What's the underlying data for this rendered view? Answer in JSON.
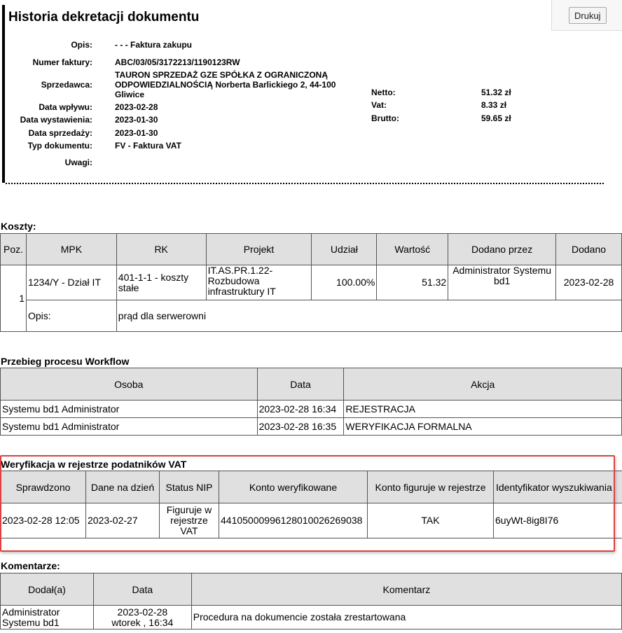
{
  "toolbar": {
    "print_label": "Drukuj"
  },
  "document": {
    "title": "Historia dekretacji dokumentu",
    "fields": {
      "opis_label": "Opis:",
      "opis_value": "- - - Faktura zakupu",
      "numer_label": "Numer faktury:",
      "numer_value": "ABC/03/05/3172213/1190123RW",
      "sprzedawca_label": "Sprzedawca:",
      "sprzedawca_value": "TAURON SPRZEDAŻ GZE SPÓŁKA Z OGRANICZONĄ ODPOWIEDZIALNOŚCIĄ Norberta Barlickiego 2, 44-100 Gliwice",
      "data_wplywu_label": "Data wpływu:",
      "data_wplywu_value": "2023-02-28",
      "data_wystawienia_label": "Data wystawienia:",
      "data_wystawienia_value": "2023-01-30",
      "data_sprzedazy_label": "Data sprzedaży:",
      "data_sprzedazy_value": "2023-01-30",
      "typ_label": "Typ dokumentu:",
      "typ_value": "FV - Faktura VAT",
      "uwagi_label": "Uwagi:",
      "uwagi_value": ""
    },
    "amounts": {
      "netto_label": "Netto:",
      "netto_value": "51.32 zł",
      "vat_label": "Vat:",
      "vat_value": "8.33 zł",
      "brutto_label": "Brutto:",
      "brutto_value": "59.65 zł"
    }
  },
  "koszty": {
    "title": "Koszty:",
    "headers": [
      "Poz.",
      "MPK",
      "RK",
      "Projekt",
      "Udział",
      "Wartość",
      "Dodano przez",
      "Dodano"
    ],
    "rows": [
      {
        "poz": "1",
        "mpk": "1234/Y - Dział IT",
        "rk": "401-1-1 - koszty stałe",
        "projekt": "IT.AS.PR.1.22-Rozbudowa infrastruktury IT",
        "udzial": "100.00%",
        "wartosc": "51.32",
        "dodano_przez": "Administrator Systemu bd1",
        "dodano": "2023-02-28",
        "opis_label": "Opis:",
        "opis_value": "prąd dla serwerowni"
      }
    ]
  },
  "workflow": {
    "title": "Przebieg procesu Workflow",
    "headers": [
      "Osoba",
      "Data",
      "Akcja"
    ],
    "rows": [
      {
        "osoba": "Systemu bd1 Administrator",
        "data": "2023-02-28 16:34",
        "akcja": "REJESTRACJA"
      },
      {
        "osoba": "Systemu bd1 Administrator",
        "data": "2023-02-28 16:35",
        "akcja": "WERYFIKACJA FORMALNA"
      }
    ]
  },
  "vat_register": {
    "title": "Weryfikacja w rejestrze podatników VAT",
    "headers": [
      "Sprawdzono",
      "Dane na dzień",
      "Status NIP",
      "Konto weryfikowane",
      "Konto figuruje w rejestrze",
      "Identyfikator wyszukiwania"
    ],
    "rows": [
      {
        "sprawdzono": "2023-02-28 12:05",
        "dane_na_dzien": "2023-02-27",
        "status_nip": "Figuruje w rejestrze VAT",
        "konto": "44105000996128010026269038",
        "figuruje": "TAK",
        "identyfikator": "6uyWt-8ig8I76"
      }
    ],
    "highlight_color": "#e04040"
  },
  "komentarze": {
    "title": "Komentarze:",
    "headers": [
      "Dodał(a)",
      "Data",
      "Komentarz"
    ],
    "rows": [
      {
        "dodal": "Administrator Systemu bd1",
        "data_line1": "2023-02-28",
        "data_line2": "wtorek , 16:34",
        "komentarz": "Procedura na dokumencie została zrestartowana"
      }
    ]
  }
}
